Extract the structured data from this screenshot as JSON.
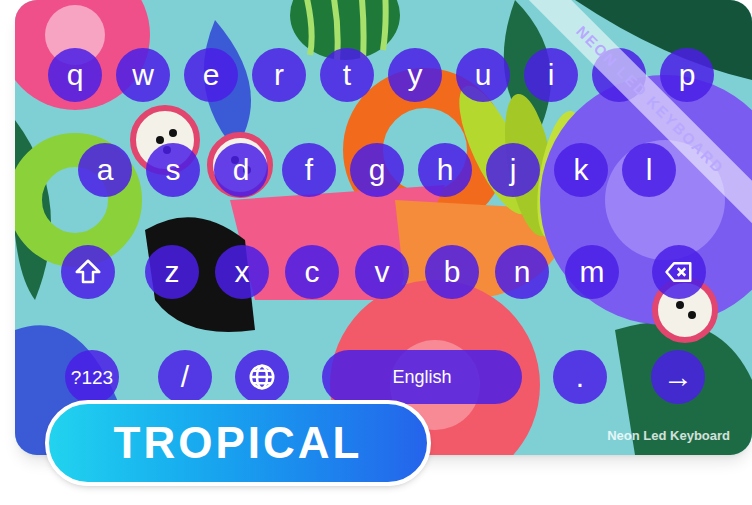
{
  "keyboard": {
    "rows": [
      [
        {
          "label": "q",
          "kind": "letter"
        },
        {
          "label": "w",
          "kind": "letter"
        },
        {
          "label": "e",
          "kind": "letter"
        },
        {
          "label": "r",
          "kind": "letter"
        },
        {
          "label": "t",
          "kind": "letter"
        },
        {
          "label": "y",
          "kind": "letter"
        },
        {
          "label": "u",
          "kind": "letter"
        },
        {
          "label": "i",
          "kind": "letter"
        },
        {
          "kind": "covered"
        },
        {
          "label": "p",
          "kind": "letter"
        }
      ],
      [
        {
          "label": "a",
          "kind": "letter"
        },
        {
          "label": "s",
          "kind": "letter"
        },
        {
          "label": "d",
          "kind": "letter"
        },
        {
          "label": "f",
          "kind": "letter"
        },
        {
          "label": "g",
          "kind": "letter"
        },
        {
          "label": "h",
          "kind": "letter"
        },
        {
          "label": "j",
          "kind": "letter"
        },
        {
          "label": "k",
          "kind": "letter"
        },
        {
          "label": "l",
          "kind": "letter"
        }
      ],
      [
        {
          "kind": "shift"
        },
        {
          "label": "z",
          "kind": "letter"
        },
        {
          "label": "x",
          "kind": "letter"
        },
        {
          "label": "c",
          "kind": "letter"
        },
        {
          "label": "v",
          "kind": "letter"
        },
        {
          "label": "b",
          "kind": "letter"
        },
        {
          "label": "n",
          "kind": "letter"
        },
        {
          "label": "m",
          "kind": "letter"
        },
        {
          "kind": "backspace"
        }
      ],
      [
        {
          "label": "?123",
          "kind": "symbols"
        },
        {
          "label": "/",
          "kind": "letter"
        },
        {
          "kind": "globe"
        },
        {
          "label": "English",
          "kind": "space"
        },
        {
          "label": ".",
          "kind": "letter"
        },
        {
          "label": "→",
          "kind": "enter"
        }
      ]
    ]
  },
  "ribbon": "NEON LED KEYBOARD",
  "watermark": "Neon Led Keyboard",
  "badge": "TROPICAL"
}
